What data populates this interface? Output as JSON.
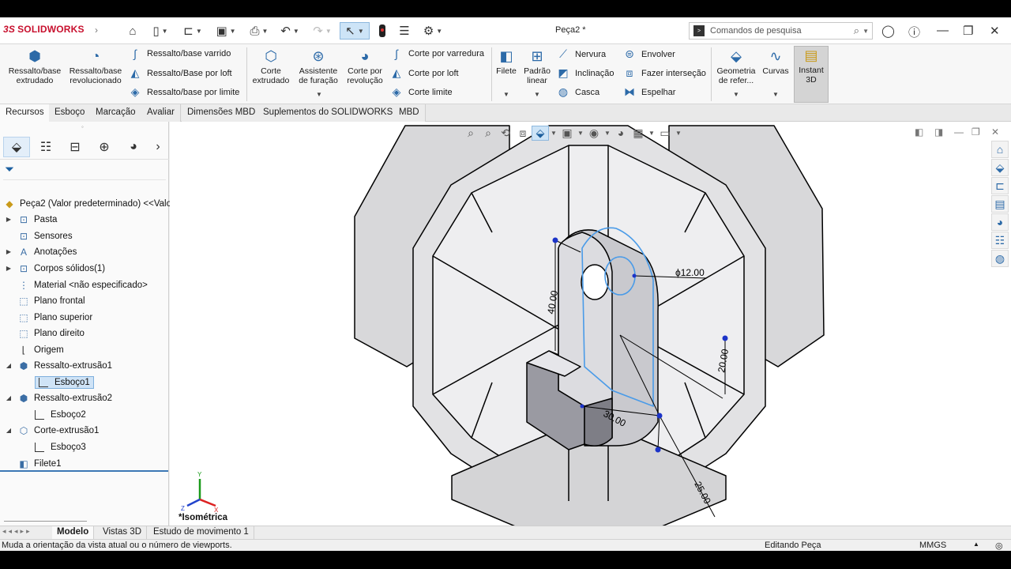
{
  "app": {
    "brand_ds": "3S",
    "brand_name": "SOLIDWORKS",
    "doc_title": "Peça2 *"
  },
  "search": {
    "placeholder": "Comandos de pesquisa"
  },
  "ribbon": {
    "extrude_boss": "Ressalto/base extrudado",
    "revolve_boss": "Ressalto/base revolucionado",
    "swept_boss": "Ressalto/base varrido",
    "loft_boss": "Ressalto/Base por loft",
    "boundary_boss": "Ressalto/base por limite",
    "extrude_cut": "Corte extrudado",
    "hole_wizard": "Assistente de furação",
    "revolve_cut": "Corte por revolução",
    "swept_cut": "Corte por varredura",
    "loft_cut": "Corte por loft",
    "boundary_cut": "Corte limite",
    "fillet": "Filete",
    "linear_pattern": "Padrão linear",
    "rib": "Nervura",
    "draft": "Inclinação",
    "shell": "Casca",
    "wrap": "Envolver",
    "intersect": "Fazer interseção",
    "mirror": "Espelhar",
    "ref_geometry": "Geometria de refer...",
    "curves": "Curvas",
    "instant3d": "Instant 3D"
  },
  "tabs": [
    "Recursos",
    "Esboço",
    "Marcação",
    "Avaliar",
    "Dimensões MBD",
    "Suplementos do SOLIDWORKS",
    "MBD"
  ],
  "tree": {
    "root": "Peça2 (Valor predeterminado) <<Valo",
    "items": [
      {
        "label": "Pasta"
      },
      {
        "label": "Sensores"
      },
      {
        "label": "Anotações"
      },
      {
        "label": "Corpos sólidos(1)"
      },
      {
        "label": "Material <não especificado>"
      },
      {
        "label": "Plano frontal"
      },
      {
        "label": "Plano superior"
      },
      {
        "label": "Plano direito"
      },
      {
        "label": "Origem"
      },
      {
        "label": "Ressalto-extrusão1"
      },
      {
        "label": "Esboço1"
      },
      {
        "label": "Ressalto-extrusão2"
      },
      {
        "label": "Esboço2"
      },
      {
        "label": "Corte-extrusão1"
      },
      {
        "label": "Esboço3"
      },
      {
        "label": "Filete1"
      }
    ]
  },
  "viewport": {
    "view_name": "*Isométrica",
    "dims": {
      "d1": "ϕ12.00",
      "d2": "40.00",
      "d3": "20.00",
      "d4": "30.00",
      "d5": "25.00"
    },
    "triad": {
      "y": "Y",
      "x": "X",
      "z": "Z"
    }
  },
  "bottom_tabs": [
    "Modelo",
    "Vistas 3D",
    "Estudo de movimento 1"
  ],
  "status": {
    "message": "Muda a orientação da vista atual ou o número de viewports.",
    "mode": "Editando Peça",
    "units": "MMGS"
  },
  "colors": {
    "accent": "#2c6aa8",
    "sketch_blue": "#4a9be8",
    "brand": "#c8102e"
  }
}
